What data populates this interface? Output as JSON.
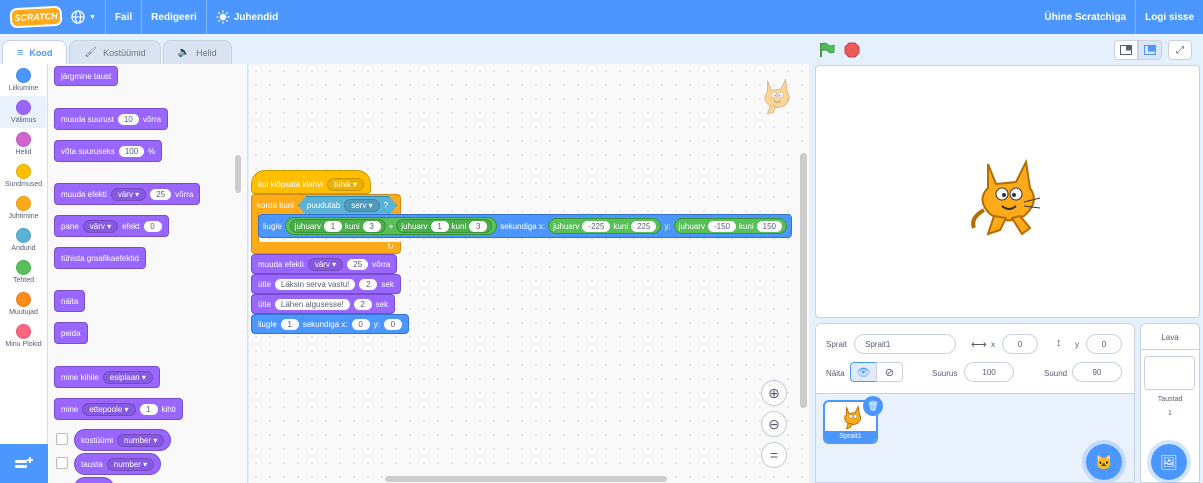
{
  "menu": {
    "logo": "SCRATCH",
    "file": "Fail",
    "edit": "Redigeeri",
    "tutorials": "Juhendid",
    "join": "Ühine Scratchiga",
    "signin": "Logi sisse"
  },
  "tabs": {
    "code": "Kood",
    "costumes": "Kostüümid",
    "sounds": "Helid"
  },
  "categories": [
    {
      "label": "Liikumine",
      "color": "#4c97ff"
    },
    {
      "label": "Välimus",
      "color": "#9966ff"
    },
    {
      "label": "Helid",
      "color": "#cf63cf"
    },
    {
      "label": "Sündmused",
      "color": "#ffbf00"
    },
    {
      "label": "Juhtimine",
      "color": "#ffab19"
    },
    {
      "label": "Andurid",
      "color": "#5cb1d6"
    },
    {
      "label": "Tehted",
      "color": "#59c059"
    },
    {
      "label": "Muutujad",
      "color": "#ff8c1a"
    },
    {
      "label": "Minu Plokid",
      "color": "#ff6680"
    }
  ],
  "palette": {
    "next_backdrop": "järgmine taust",
    "change_size": {
      "a": "muuda suurust",
      "v": "10",
      "b": "võrra"
    },
    "set_size": {
      "a": "võta suuruseks",
      "v": "100",
      "b": "%"
    },
    "change_effect": {
      "a": "muuda efekti",
      "dd": "värv",
      "v": "25",
      "b": "võrra"
    },
    "set_effect": {
      "a": "pane",
      "dd": "värv",
      "b": "efekt",
      "v": "0"
    },
    "clear_effects": "tühista graafikaefektid",
    "show": "näita",
    "hide": "peida",
    "go_layer": {
      "a": "mine kihile",
      "dd": "esiplaan"
    },
    "go_layers": {
      "a": "mine",
      "dd": "ettepoole",
      "v": "1",
      "b": "kihti"
    },
    "costume": {
      "a": "kostüümi",
      "dd": "number"
    },
    "backdrop": {
      "a": "tausta",
      "dd": "number"
    }
  },
  "script": {
    "hat": {
      "a": "kui klõpsata klahvi",
      "dd": "tühik"
    },
    "repeat": {
      "a": "korda kuni",
      "sa": "puudutab",
      "dd": "serv",
      "q": "?"
    },
    "glide_random": {
      "a": "liugle",
      "r1a": "juhuarv",
      "r1v1": "1",
      "k1": "kuni",
      "r1v2": "3",
      "plus": "+",
      "r2a": "juhuarv",
      "r2v1": "1",
      "k2": "kuni",
      "r2v2": "3",
      "b": "sekundiga x:",
      "rxa": "juhuarv",
      "rxv1": "-225",
      "kx": "kuni",
      "rxv2": "225",
      "y": "y:",
      "rya": "juhuarv",
      "ryv1": "-150",
      "ky": "kuni",
      "ryv2": "150"
    },
    "change_effect": {
      "a": "muuda efekti",
      "dd": "värv",
      "v": "25",
      "b": "võrra"
    },
    "say1": {
      "a": "ütle",
      "t": "Läksin serva vastu!",
      "v": "2",
      "b": "sek"
    },
    "say2": {
      "a": "ütle",
      "t": "Lähen algusesse!",
      "v": "2",
      "b": "sek"
    },
    "glide_home": {
      "a": "liugle",
      "v": "1",
      "b": "sekundiga x:",
      "x": "0",
      "c": "y:",
      "y": "0"
    }
  },
  "zoom": {
    "reset": "="
  },
  "sprite_info": {
    "sprite_label": "Sprait",
    "sprite_name": "Sprait1",
    "x_label": "x",
    "x": "0",
    "y_label": "y",
    "y": "0",
    "show_label": "Näita",
    "size_label": "Suurus",
    "size": "100",
    "direction_label": "Suund",
    "direction": "90"
  },
  "sprites": [
    {
      "name": "Sprait1"
    }
  ],
  "stage_panel": {
    "title": "Lava",
    "backdrops_label": "Taustad",
    "backdrops_count": "1"
  }
}
